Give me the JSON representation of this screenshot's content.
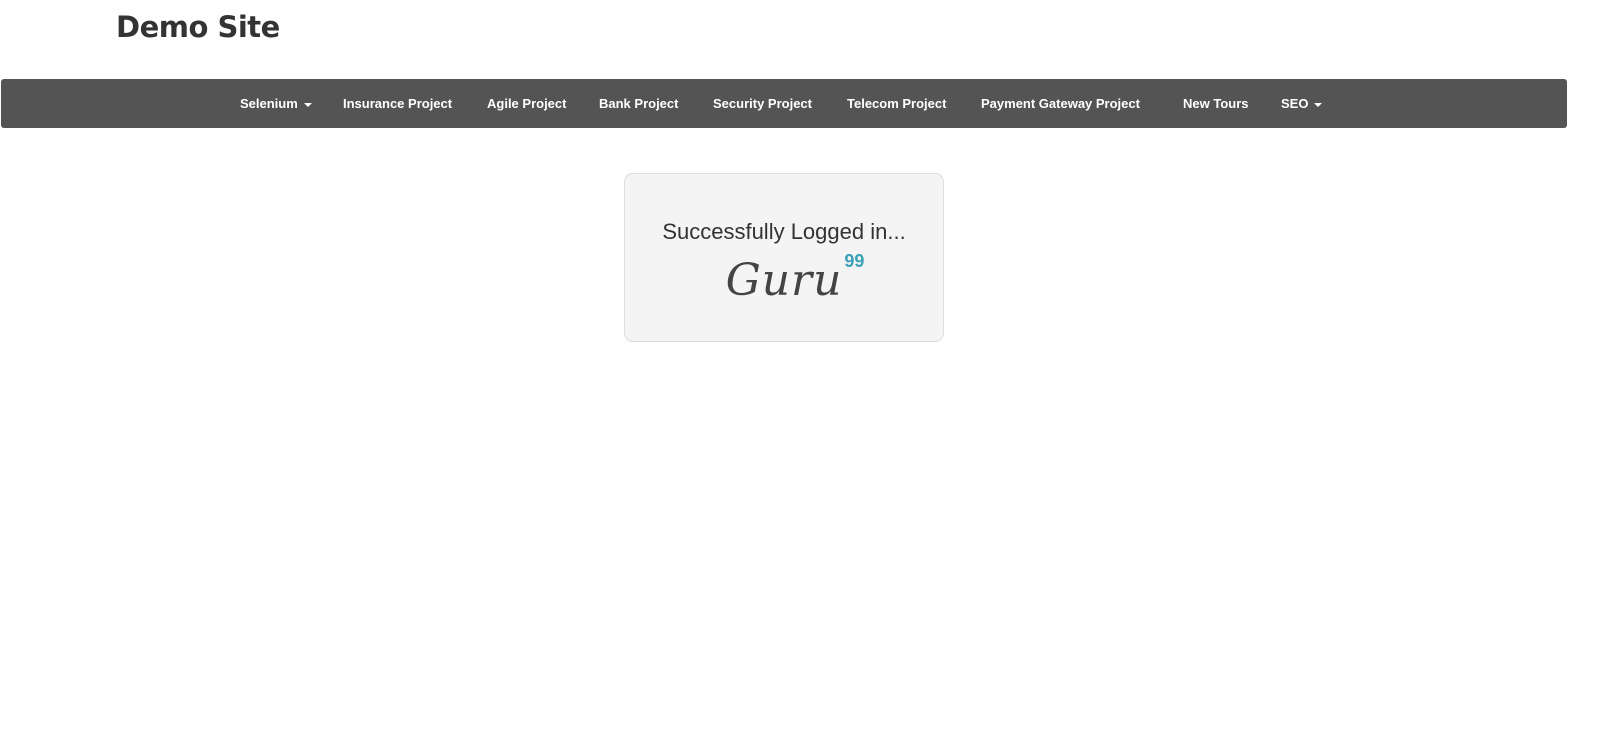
{
  "brand": "Demo Site",
  "nav": {
    "items": [
      {
        "label": "Selenium",
        "dropdown": true
      },
      {
        "label": "Insurance Project"
      },
      {
        "label": "Agile Project"
      },
      {
        "label": "Bank Project"
      },
      {
        "label": "Security Project"
      },
      {
        "label": "Telecom Project"
      },
      {
        "label": "Payment Gateway Project"
      },
      {
        "label": "New Tours"
      },
      {
        "label": "SEO",
        "dropdown": true
      }
    ]
  },
  "card": {
    "message": "Successfully Logged in...",
    "logo_text": "Guru",
    "logo_sup": "99"
  },
  "colors": {
    "navbar": "#545454",
    "accent": "#3aa1b6"
  }
}
